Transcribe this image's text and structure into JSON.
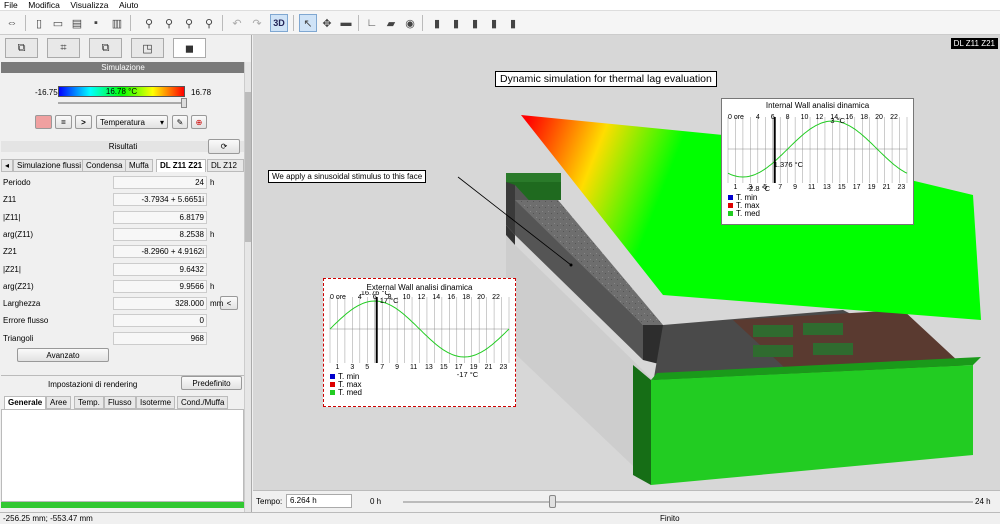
{
  "menu": [
    "File",
    "Modifica",
    "Visualizza",
    "Aiuto"
  ],
  "toolbar": {
    "view3d_label": "3D"
  },
  "simulation": {
    "header": "Simulazione",
    "min": "-16.75",
    "max": "16.78",
    "current": "16.78 °C",
    "quantity": "Temperatura",
    "eq_label": "=",
    "next_label": ">",
    "colors": {
      "cold": "#0000ff",
      "mid": "#00ff00",
      "hot": "#ff0000"
    }
  },
  "results": {
    "header": "Risultati",
    "tabs": [
      "Simulazione flussi",
      "Condensa",
      "Muffa",
      "DL Z11 Z21",
      "DL Z12"
    ],
    "rows": [
      {
        "label": "Periodo",
        "value": "24",
        "unit": "h"
      },
      {
        "label": "Z11",
        "value": "-3.7934 + 5.6651i",
        "unit": ""
      },
      {
        "label": "|Z11|",
        "value": "6.8179",
        "unit": ""
      },
      {
        "label": "arg(Z11)",
        "value": "8.2538",
        "unit": "h"
      },
      {
        "label": "Z21",
        "value": "-8.2960 + 4.9162i",
        "unit": ""
      },
      {
        "label": "|Z21|",
        "value": "9.6432",
        "unit": ""
      },
      {
        "label": "arg(Z21)",
        "value": "9.9566",
        "unit": "h"
      },
      {
        "label": "Larghezza",
        "value": "328.000",
        "unit": "mm"
      },
      {
        "label": "Errore flusso",
        "value": "0",
        "unit": ""
      },
      {
        "label": "Triangoli",
        "value": "968",
        "unit": ""
      }
    ],
    "small_btn": "<",
    "advanced": "Avanzato"
  },
  "rendering": {
    "header": "Impostazioni di rendering",
    "default_btn": "Predefinito",
    "tabs": [
      "Generale",
      "Aree",
      "Temp.",
      "Flusso",
      "Isoterme",
      "Cond./Muffa"
    ]
  },
  "viewport": {
    "corner_label": "DL Z11 Z21",
    "title": "Dynamic simulation for thermal lag evaluation",
    "note": "We apply a sinusoidal stimulus to this face"
  },
  "internal_chart": {
    "title": "Internal Wall analisi dinamica",
    "top_label": "0 ore",
    "ticks_top": [
      "4",
      "6",
      "8",
      "10",
      "12",
      "14",
      "16",
      "18",
      "20",
      "22"
    ],
    "ticks_bottom": [
      "1",
      "3",
      "5",
      "7",
      "9",
      "11",
      "13",
      "15",
      "17",
      "19",
      "21",
      "23"
    ],
    "max_label": "3 °C",
    "mid_label": "1.376 °C",
    "min_label": "-2.8 °C",
    "legend": [
      "T. min",
      "T. max",
      "T. med"
    ],
    "legend_colors": [
      "#0000cc",
      "#dd0000",
      "#22cc22"
    ]
  },
  "external_chart": {
    "title": "External Wall analisi dinamica",
    "top_label": "0 ore",
    "ticks_top": [
      "4",
      "6",
      "8",
      "10",
      "12",
      "14",
      "16",
      "18",
      "20",
      "22"
    ],
    "ticks_bottom": [
      "1",
      "3",
      "5",
      "7",
      "9",
      "11",
      "13",
      "15",
      "17",
      "19",
      "21",
      "23"
    ],
    "peak_label": "16.76 °C",
    "max_label": "17 °C",
    "min_label": "-17 °C",
    "legend": [
      "T. min",
      "T. max",
      "T. med"
    ],
    "legend_colors": [
      "#0000cc",
      "#dd0000",
      "#22cc22"
    ]
  },
  "timebar": {
    "label": "Tempo:",
    "value": "6.264 h",
    "start": "0 h",
    "end": "24 h",
    "position": 0.261
  },
  "status": {
    "coords": "-256.25 mm; -553.47 mm",
    "state": "Finito"
  }
}
